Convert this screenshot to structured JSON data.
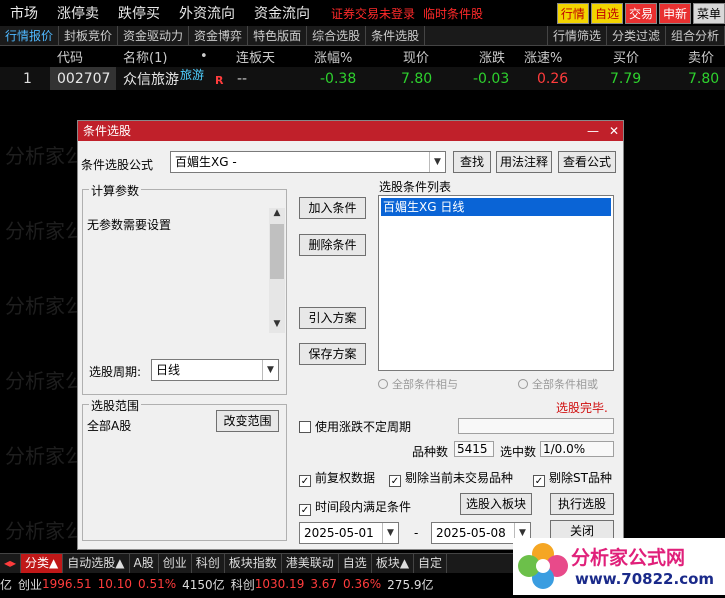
{
  "menubar": {
    "items": [
      "市场",
      "涨停卖",
      "跌停买",
      "外资流向",
      "资金流向"
    ],
    "warning": "证券交易未登录",
    "warning2": "临时条件股",
    "right_buttons": [
      "行情",
      "自选",
      "交易",
      "申新",
      "菜单"
    ]
  },
  "tabs": {
    "left": [
      "行情报价",
      "封板竞价",
      "资金驱动力",
      "资金博弈",
      "特色版面",
      "综合选股",
      "条件选股"
    ],
    "right": [
      "行情筛选",
      "分类过滤",
      "组合分析"
    ]
  },
  "table": {
    "headers": [
      "代码",
      "名称(1)",
      "•",
      "连板天",
      "涨幅%",
      "现价",
      "涨跌",
      "涨速%",
      "买价",
      "卖价"
    ],
    "row": {
      "index": "1",
      "code": "002707",
      "name": "众信旅游",
      "tag": "旅游",
      "flag": "R",
      "lianban": "--",
      "change_pct": "-0.38",
      "price": "7.80",
      "change": "-0.03",
      "speed": "0.26",
      "bid": "7.79",
      "ask": "7.80"
    }
  },
  "watermark": "分析家公式网www.70822.com",
  "dialog": {
    "title": "条件选股",
    "formula_label": "条件选股公式",
    "formula_value": "百媚生XG  -",
    "btn_find": "查找",
    "btn_usage": "用法注释",
    "btn_view": "查看公式",
    "params_title": "计算参数",
    "params_text": "无参数需要设置",
    "btn_add": "加入条件",
    "btn_delete": "删除条件",
    "btn_import": "引入方案",
    "btn_save": "保存方案",
    "list_title": "选股条件列表",
    "list_item": "百媚生XG  日线",
    "radio_and": "全部条件相与",
    "radio_or": "全部条件相或",
    "status": "选股完毕.",
    "period_label": "选股周期:",
    "period_value": "日线",
    "range_title": "选股范围",
    "range_value": "全部A股",
    "btn_change_range": "改变范围",
    "chk_uncertain": "使用涨跌不定周期",
    "count_label": "品种数",
    "count_value": "5415",
    "selected_label": "选中数",
    "selected_value": "1/0.0%",
    "chk_fuquan": "前复权数据",
    "chk_exclude_untraded": "剔除当前未交易品种",
    "chk_exclude_st": "剔除ST品种",
    "chk_period": "时间段内满足条件",
    "btn_to_block": "选股入板块",
    "btn_execute": "执行选股",
    "date_from": "2025-05-01",
    "date_sep": "-",
    "date_to": "2025-05-08",
    "btn_close": "关闭"
  },
  "bottom_tabs": [
    "分类▲",
    "自动选股▲",
    "A股",
    "创业",
    "科创",
    "板块指数",
    "港美联动",
    "自选",
    "板块▲",
    "自定"
  ],
  "status": {
    "prefix": "亿",
    "cy_label": "创业",
    "cy_value": "1996.51",
    "cy_change": "10.10",
    "cy_pct": "0.51%",
    "cy_amount": "4150亿",
    "kc_label": "科创",
    "kc_value": "1030.19",
    "kc_change": "3.67",
    "kc_pct": "0.36%",
    "kc_amount": "275.9亿"
  },
  "logo": {
    "text": "分析家公式网",
    "url": "www.70822.com"
  },
  "colors": {
    "accent_red": "#c0202a",
    "up_red": "#ff3c3c",
    "down_green": "#2ed12e",
    "selected_blue": "#0a64d6",
    "tab_blue": "#4fb8ff"
  }
}
